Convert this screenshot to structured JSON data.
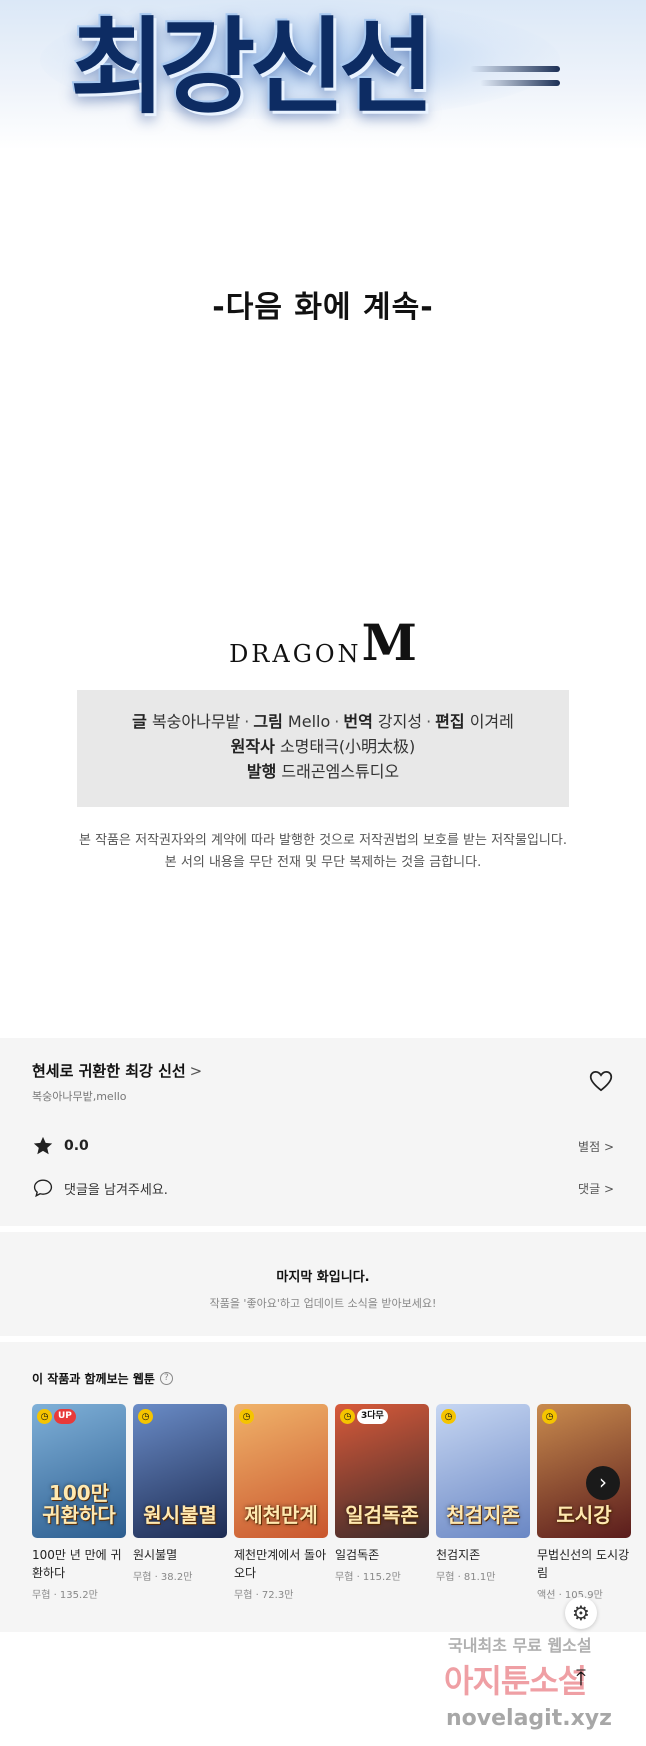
{
  "banner": {
    "logo_text": "최강신선"
  },
  "episode": {
    "continued_text": "-다음 화에 계속-"
  },
  "publisher": {
    "logo_word": "DRAGON",
    "logo_letter": "M"
  },
  "credits": {
    "writer_label": "글",
    "writer": "복숭아나무밭",
    "art_label": "그림",
    "art": "Mello",
    "translation_label": "번역",
    "translation": "강지성",
    "editor_label": "편집",
    "editor": "이겨레",
    "original_label": "원작사",
    "original": "소명태극(小明太极)",
    "publish_label": "발행",
    "publish": "드래곤엠스튜디오",
    "separator": "·"
  },
  "copyright": {
    "line1": "본 작품은 저작권자와의 계약에 따라 발행한 것으로 저작권법의 보호를 받는 저작물입니다.",
    "line2": "본 서의 내용을 무단 전재 및 무단 복제하는 것을 금합니다."
  },
  "work": {
    "title": "현세로 귀환한 최강 신선",
    "title_chevron": ">",
    "authors": "복숭아나무밭,mello",
    "rating": "0.0",
    "rating_link": "별점 >",
    "comment_placeholder": "댓글을 남겨주세요.",
    "comment_link": "댓글 >"
  },
  "last_episode": {
    "title": "마지막 화입니다.",
    "subtitle": "작품을 '좋아요'하고 업데이트 소식을 받아보세요!"
  },
  "recommendations": {
    "heading": "이 작품과 함께보는 웹툰",
    "help": "?",
    "items": [
      {
        "name": "100만 년 만에 귀환하다",
        "meta": "무협 · 135.2만",
        "badge": "UP",
        "art": "100만 귀환하다",
        "colors": [
          "#2c5d8f",
          "#7fb0d8"
        ],
        "badge_color": "#e83a3a"
      },
      {
        "name": "원시불멸",
        "meta": "무협 · 38.2만",
        "badge": "",
        "art": "원시불멸",
        "colors": [
          "#1d2b52",
          "#6a8cc7"
        ],
        "badge_color": ""
      },
      {
        "name": "제천만계에서 돌아오다",
        "meta": "무협 · 72.3만",
        "badge": "",
        "art": "제천만계",
        "colors": [
          "#c9562e",
          "#f0b36a"
        ],
        "badge_color": ""
      },
      {
        "name": "일검독존",
        "meta": "무협 · 115.2만",
        "badge": "3다무",
        "art": "일검독존",
        "colors": [
          "#3b2a2a",
          "#d85a3a"
        ],
        "badge_color": "#ffffff"
      },
      {
        "name": "천검지존",
        "meta": "무협 · 81.1만",
        "badge": "",
        "art": "천검지존",
        "colors": [
          "#6a87c4",
          "#c6d6f2"
        ],
        "badge_color": ""
      },
      {
        "name": "무법신선의 도시강림",
        "meta": "액션 · 105.9만",
        "badge": "",
        "art": "도시강",
        "colors": [
          "#5a1c1c",
          "#c98b4e"
        ],
        "badge_color": ""
      }
    ],
    "next_icon": "›"
  },
  "floating": {
    "settings_icon": "⚙",
    "top_icon": "⤒"
  },
  "watermark": {
    "line1": "국내최초 무료 웹소설",
    "line2": "아지툰소설",
    "line3": "novelagit.xyz"
  }
}
